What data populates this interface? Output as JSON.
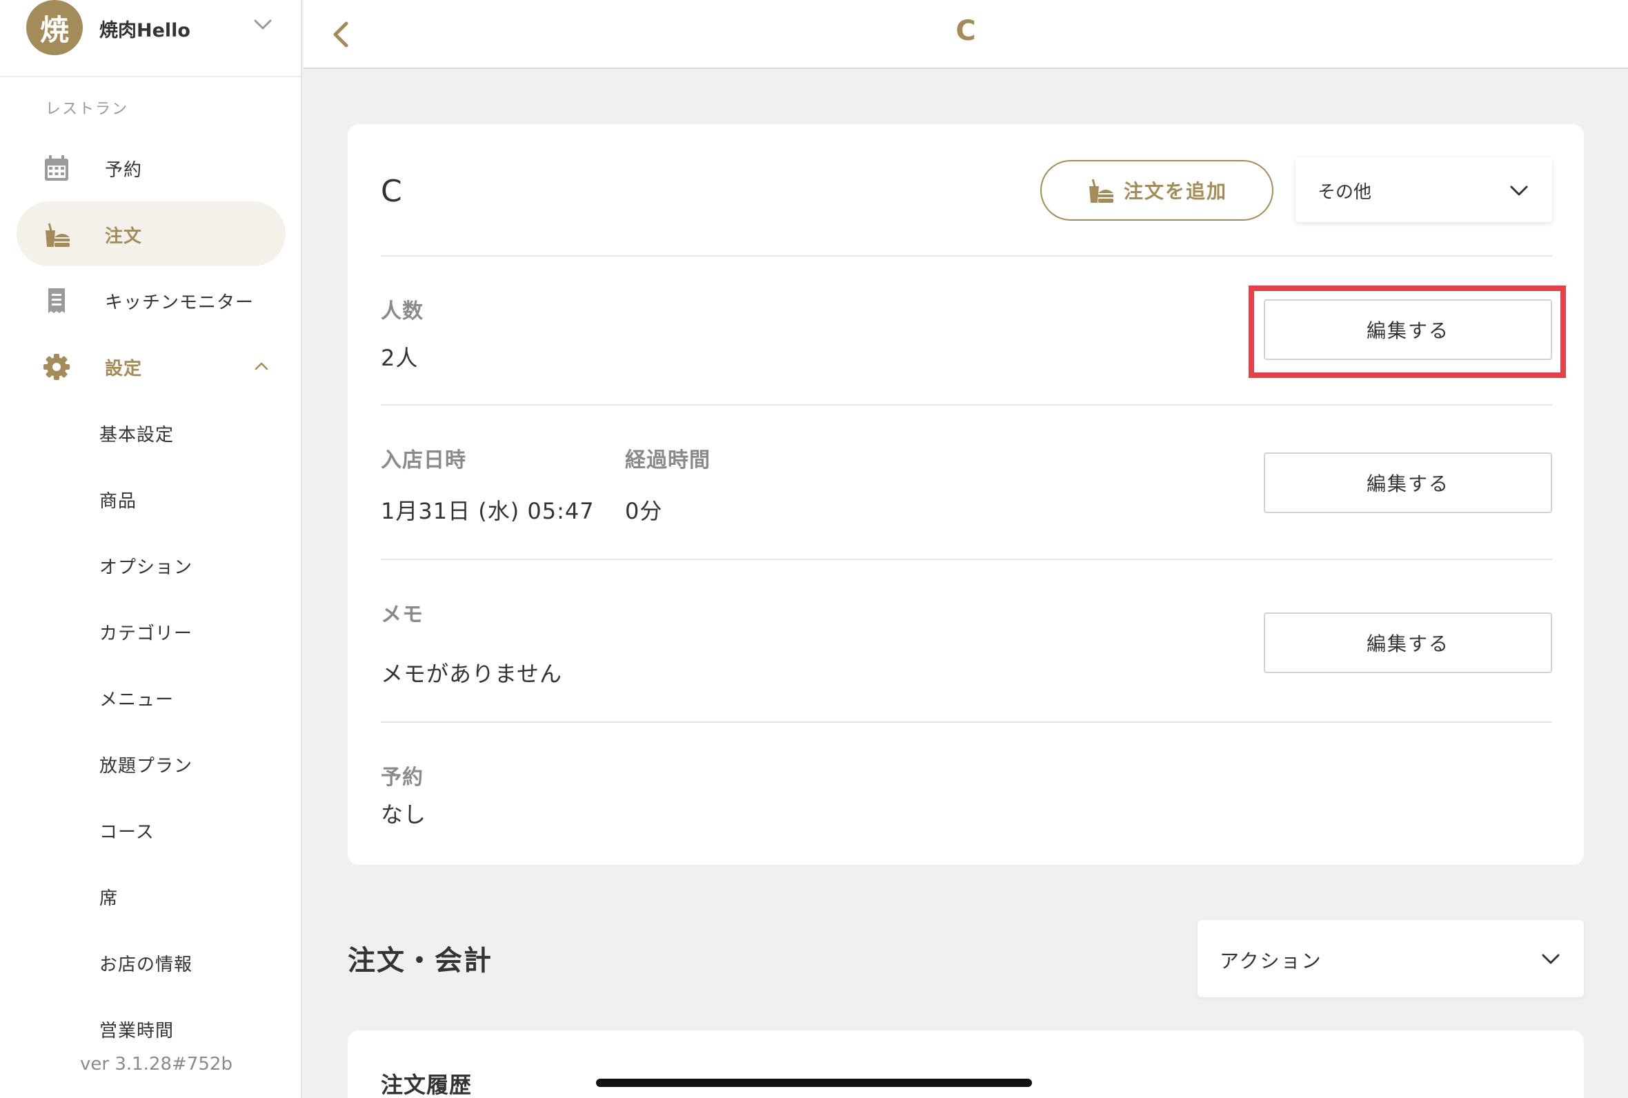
{
  "sidebar": {
    "avatar_char": "焼",
    "restaurant_name": "焼肉Hello",
    "section_label": "レストラン",
    "nav": {
      "reservation": "予約",
      "order": "注文",
      "kitchen": "キッチンモニター",
      "settings": "設定"
    },
    "settings_items": [
      "基本設定",
      "商品",
      "オプション",
      "カテゴリー",
      "メニュー",
      "放題プラン",
      "コース",
      "席",
      "お店の情報",
      "営業時間"
    ],
    "version": "ver 3.1.28#752b"
  },
  "header": {
    "title": "C"
  },
  "card": {
    "title": "C",
    "add_order_label": "注文を追加",
    "other_select_value": "その他",
    "guests_label": "人数",
    "guests_value": "2人",
    "checkin_label": "入店日時",
    "checkin_value": "1月31日 (水) 05:47",
    "elapsed_label": "経過時間",
    "elapsed_value": "0分",
    "memo_label": "メモ",
    "memo_value": "メモがありません",
    "reservation_label": "予約",
    "reservation_value": "なし",
    "edit_label": "編集する"
  },
  "orders": {
    "title": "注文・会計",
    "action_select_value": "アクション",
    "history_title": "注文履歴"
  },
  "colors": {
    "accent": "#a48c5a",
    "highlight": "#e4424b",
    "background": "#f0f0f0"
  }
}
